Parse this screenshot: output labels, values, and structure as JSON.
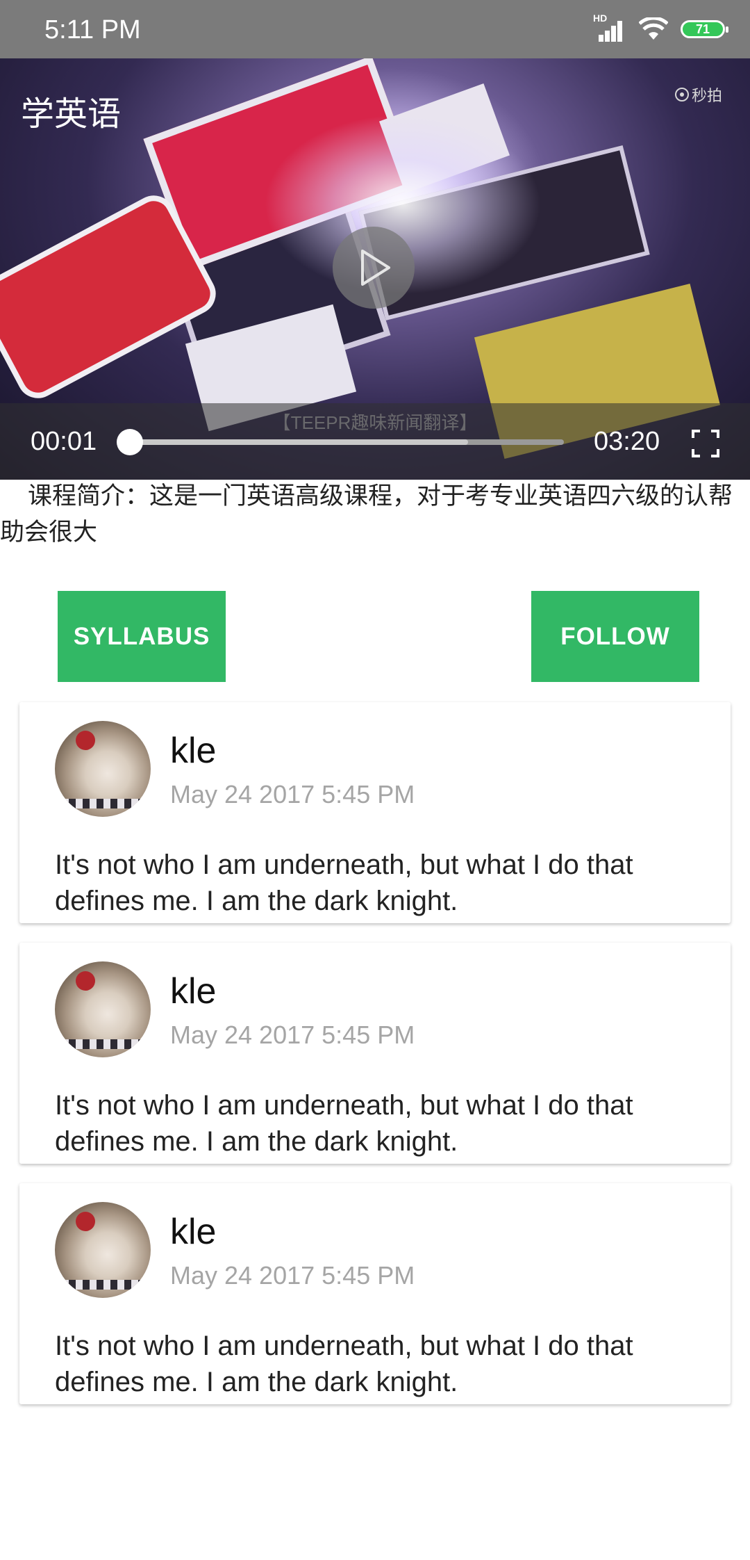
{
  "status_bar": {
    "time": "5:11 PM",
    "network_label": "HD",
    "battery_level": "71"
  },
  "video": {
    "title": "学英语",
    "watermark": "秒拍",
    "subtitle": "【TEEPR趣味新闻翻译】",
    "current_time": "00:01",
    "total_time": "03:20",
    "progress_fraction": 0.005,
    "buffered_fraction": 0.78
  },
  "course": {
    "intro": "课程简介：这是一门英语高级课程，对于考专业英语四六级的认帮助会很大"
  },
  "actions": {
    "syllabus_label": "SYLLABUS",
    "follow_label": "FOLLOW"
  },
  "comments": [
    {
      "name": "kle",
      "date": "May 24 2017 5:45 PM",
      "text": "It's not who I am underneath, but what I do that defines me. I am the dark knight."
    },
    {
      "name": "kle",
      "date": "May 24 2017 5:45 PM",
      "text": "It's not who I am underneath, but what I do that defines me. I am the dark knight."
    },
    {
      "name": "kle",
      "date": "May 24 2017 5:45 PM",
      "text": "It's not who I am underneath, but what I do that defines me. I am the dark knight."
    }
  ],
  "colors": {
    "accent": "#32b865",
    "status_bar": "#7b7b7b",
    "battery": "#34c759"
  }
}
